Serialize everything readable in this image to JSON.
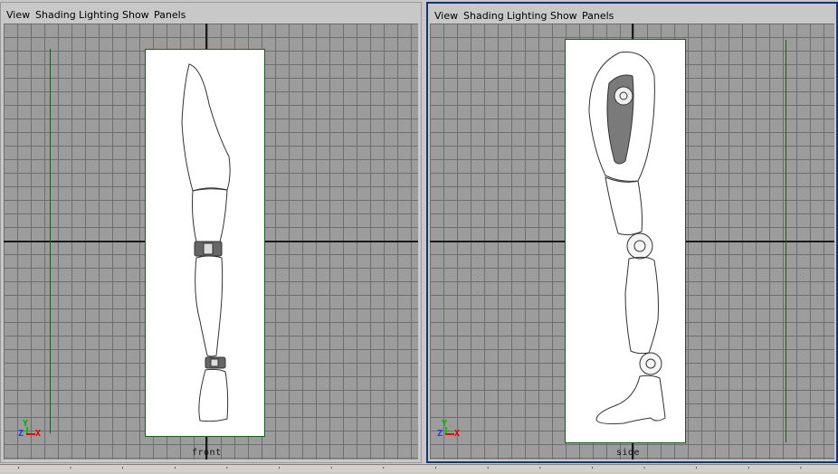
{
  "left_panel": {
    "menu": {
      "view": "View",
      "shading": "Shading",
      "lighting": "Lighting",
      "show": "Show",
      "panels": "Panels"
    },
    "camera_label": "front",
    "gizmo": {
      "y": "Y",
      "z": "Z",
      "x": "X"
    }
  },
  "right_panel": {
    "menu": {
      "view": "View",
      "shading": "Shading",
      "lighting": "Lighting",
      "show": "Show",
      "panels": "Panels"
    },
    "camera_label": "side",
    "gizmo": {
      "y": "Y",
      "z": "Z",
      "x": "X"
    },
    "active": true
  },
  "colors": {
    "active_border": "#16356e",
    "grid_background": "#9c9c9c",
    "grid_line": "#6e6e6e",
    "axis": "#1a1a1a",
    "image_plane_border": "#1e5a1e"
  },
  "status_bar": {
    "marks": "' ' ' ' ' ' ' ' ' ' ' ' ' ' ' '"
  }
}
